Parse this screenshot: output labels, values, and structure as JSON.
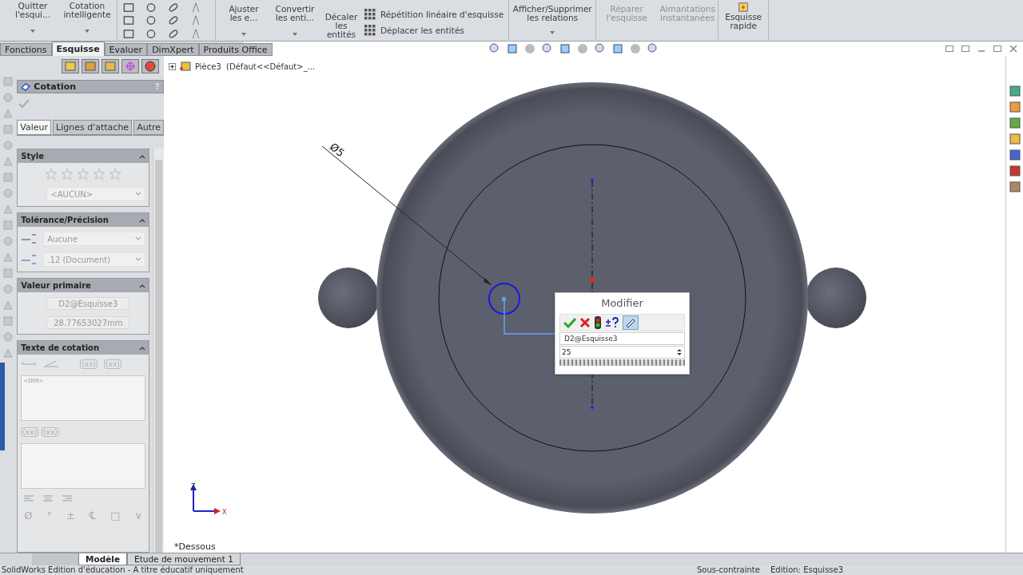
{
  "ribbon": {
    "large_buttons": [
      {
        "label": "Quitter l'esqui...",
        "disabled": false
      },
      {
        "label": "Cotation intelligente",
        "disabled": false
      }
    ],
    "edit_buttons": [
      {
        "label": "Ajuster les e...",
        "disabled": false
      },
      {
        "label": "Convertir les enti...",
        "disabled": false
      },
      {
        "label": "Décaler les entités",
        "disabled": false
      }
    ],
    "small_commands": [
      "Répétition linéaire d'esquisse",
      "Déplacer les entités"
    ],
    "right_buttons": [
      {
        "label": "Afficher/Supprimer les relations",
        "disabled": false
      },
      {
        "label": "Réparer l'esquisse",
        "disabled": true
      },
      {
        "label": "Aimantations instantanées",
        "disabled": true
      },
      {
        "label": "Esquisse rapide",
        "disabled": false
      }
    ]
  },
  "command_tabs": [
    {
      "label": "Fonctions",
      "selected": false
    },
    {
      "label": "Esquisse",
      "selected": true
    },
    {
      "label": "Evaluer",
      "selected": false
    },
    {
      "label": "DimXpert",
      "selected": false
    },
    {
      "label": "Produits Office",
      "selected": false
    }
  ],
  "property_manager": {
    "title": "Cotation",
    "help": "?",
    "tabs": [
      {
        "label": "Valeur",
        "selected": true
      },
      {
        "label": "Lignes d'attache",
        "selected": false
      },
      {
        "label": "Autre",
        "selected": false
      }
    ],
    "style": {
      "title": "Style",
      "dropdown": "<AUCUN>"
    },
    "tolerance": {
      "title": "Tolérance/Précision",
      "tolerance_dropdown": "Aucune",
      "precision_dropdown": ".12 (Document)"
    },
    "primary_value": {
      "title": "Valeur primaire",
      "name": "D2@Esquisse3",
      "value": "28.77653027mm"
    },
    "dimension_text": {
      "title": "Texte de cotation",
      "top_buttons": [
        "(xx)",
        "(xx)"
      ],
      "text": "<DIM>",
      "bottom_buttons": [
        "(xx)",
        "(xx)"
      ],
      "symbols": [
        "Ø",
        "°",
        "±",
        "℄",
        "□",
        "∨"
      ]
    }
  },
  "graphics": {
    "tree_item": "Pièce3  (Défaut<<Défaut>_...",
    "dimension": "Ø5",
    "view_label": "*Dessous",
    "triad": [
      "Z",
      "X"
    ],
    "modify_dialog": {
      "title": "Modifier",
      "name": "D2@Esquisse3",
      "value": "25"
    }
  },
  "bottom_tabs": [
    {
      "label": "Modèle",
      "selected": true
    },
    {
      "label": "Etude de mouvement 1",
      "selected": false
    }
  ],
  "status_bar": {
    "product": "SolidWorks Edition d'éducation - A titre éducatif uniquement",
    "constraint": "Sous-contrainte",
    "editing": "Edition: Esquisse3"
  }
}
